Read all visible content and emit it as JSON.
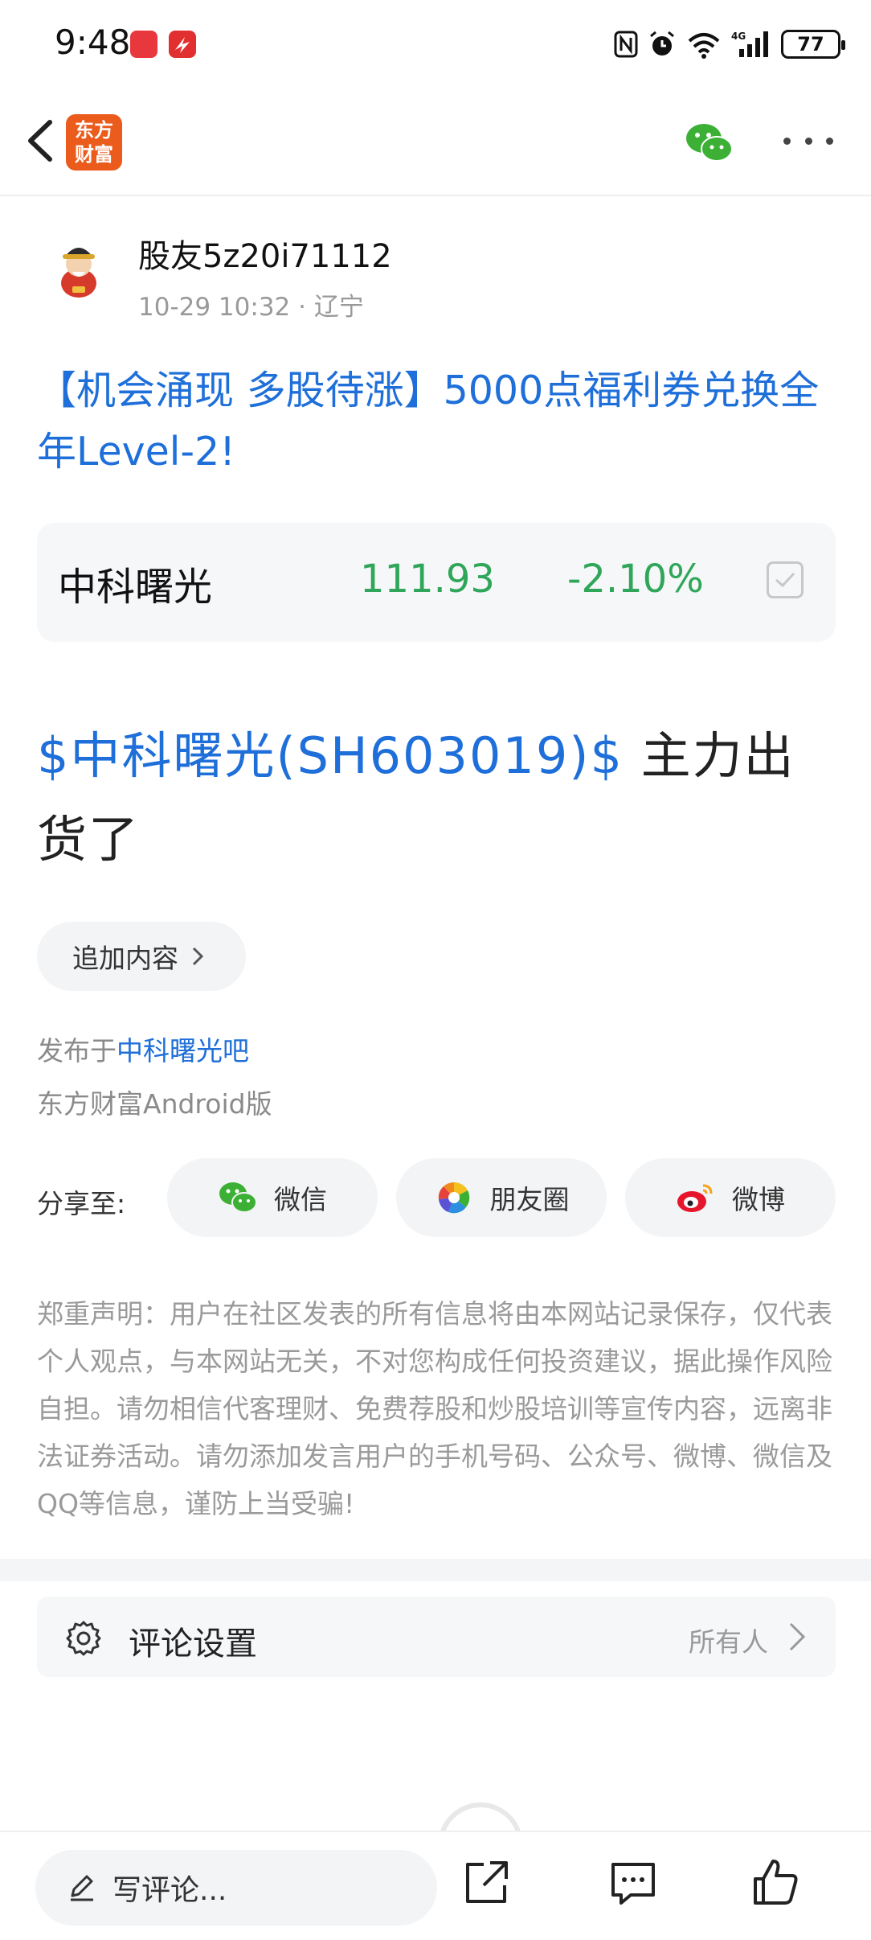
{
  "status_bar": {
    "time": "9:48",
    "battery": "77",
    "icons": [
      "huawei-store-icon",
      "app-notification-icon",
      "nfc-icon",
      "alarm-icon",
      "wifi-icon",
      "4g-signal-icon",
      "battery-icon"
    ]
  },
  "nav": {
    "logo_text_line1": "东方",
    "logo_text_line2": "财富",
    "brand_color": "#ea5b1c",
    "icons": [
      "back-arrow-icon",
      "wechat-icon",
      "more-icon"
    ]
  },
  "author": {
    "name": "股友5z20i71112",
    "meta": "10-29 10:32 · 辽宁"
  },
  "post": {
    "title": "【机会涌现 多股待涨】5000点福利券兑换全年Level-2!",
    "stock_link": "$中科曙光(SH603019)$",
    "body_text": " 主力出货了",
    "append_label": "追加内容",
    "publish_prefix": "发布于",
    "publish_bar": "中科曙光吧",
    "client": "东方财富Android版"
  },
  "stock_card": {
    "name": "中科曙光",
    "price": "111.93",
    "change": "-2.10%",
    "change_color": "#2fa659"
  },
  "share": {
    "label": "分享至:",
    "wechat": "微信",
    "moments": "朋友圈",
    "weibo": "微博"
  },
  "disclaimer": "郑重声明：用户在社区发表的所有信息将由本网站记录保存，仅代表个人观点，与本网站无关，不对您构成任何投资建议，据此操作风险自担。请勿相信代客理财、免费荐股和炒股培训等宣传内容，远离非法证券活动。请勿添加发言用户的手机号码、公众号、微博、微信及QQ等信息，谨防上当受骗!",
  "comment_settings": {
    "label": "评论设置",
    "value": "所有人"
  },
  "bottom_bar": {
    "comment_placeholder": "写评论...",
    "icons": [
      "pencil-icon",
      "share-export-icon",
      "comment-icon",
      "like-icon"
    ]
  },
  "accent_color": "#1e6fd9"
}
